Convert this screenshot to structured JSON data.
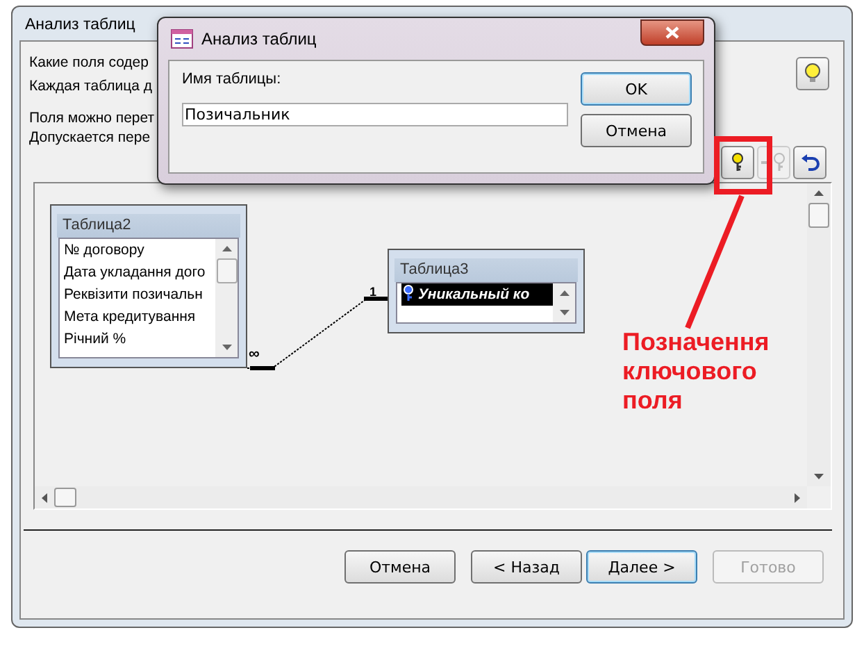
{
  "window": {
    "title": "Анализ таблиц"
  },
  "instructions": [
    {
      "text": "Какие поля содер"
    },
    {
      "text": "Каждая таблица д"
    },
    {
      "text": "Поля можно перет"
    },
    {
      "text": "Допускается пере"
    }
  ],
  "hint_button": {
    "disabled": false
  },
  "toolbar": [
    {
      "kind": "set-key",
      "disabled": false
    },
    {
      "kind": "remove-key",
      "disabled": true
    },
    {
      "kind": "undo",
      "disabled": false
    }
  ],
  "tables": [
    {
      "title": "Таблица2",
      "fields": [
        {
          "name": "№ договору",
          "key": false,
          "selected": false
        },
        {
          "name": "Дата укладання дого",
          "key": false,
          "selected": false
        },
        {
          "name": "Реквізити позичальн",
          "key": false,
          "selected": false
        },
        {
          "name": "Мета кредитування",
          "key": false,
          "selected": false
        },
        {
          "name": "Річний %",
          "key": false,
          "selected": false
        }
      ]
    },
    {
      "title": "Таблица3",
      "fields": [
        {
          "name": "Уникальный ко",
          "key": true,
          "selected": true
        }
      ]
    }
  ],
  "relationship": {
    "many_label": "∞",
    "one_label": "1"
  },
  "buttons": [
    {
      "label": "Отмена",
      "default": false,
      "disabled": false
    },
    {
      "label": "< Назад",
      "default": false,
      "disabled": false
    },
    {
      "label": "Далее >",
      "default": true,
      "disabled": false
    },
    {
      "label": "Готово",
      "default": false,
      "disabled": true
    }
  ],
  "modal": {
    "title": "Анализ таблиц",
    "label": "Имя таблицы:",
    "value": "Позичальник",
    "buttons": [
      {
        "label": "OK",
        "default": true
      },
      {
        "label": "Отмена",
        "default": false
      }
    ]
  },
  "annotation": {
    "text": "Позначення ключового поля"
  }
}
